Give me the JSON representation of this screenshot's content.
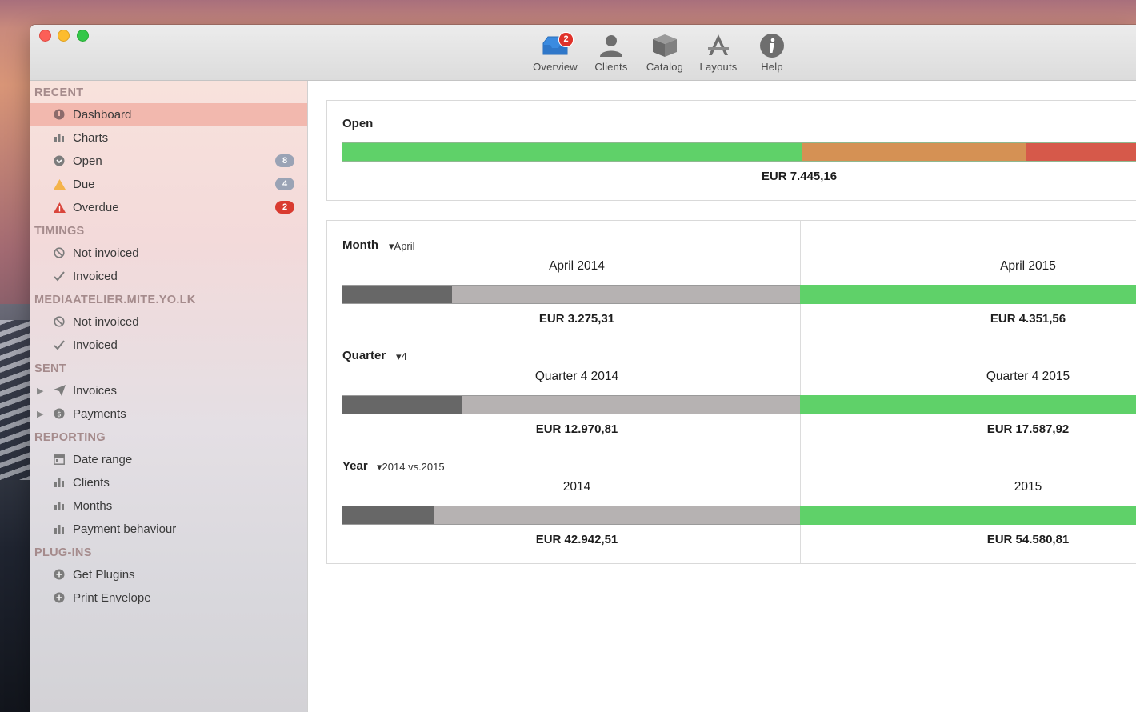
{
  "toolbar": {
    "overview": {
      "label": "Overview",
      "badge": "2"
    },
    "clients": {
      "label": "Clients"
    },
    "catalog": {
      "label": "Catalog"
    },
    "layouts": {
      "label": "Layouts"
    },
    "help": {
      "label": "Help"
    }
  },
  "sidebar": {
    "recent": {
      "header": "RECENT",
      "dashboard": "Dashboard",
      "charts": "Charts",
      "open": "Open",
      "open_badge": "8",
      "due": "Due",
      "due_badge": "4",
      "overdue": "Overdue",
      "overdue_badge": "2"
    },
    "timings": {
      "header": "TIMINGS",
      "not_invoiced": "Not invoiced",
      "invoiced": "Invoiced"
    },
    "account": {
      "header": "MEDIAATELIER.MITE.YO.LK",
      "not_invoiced": "Not invoiced",
      "invoiced": "Invoiced"
    },
    "sent": {
      "header": "SENT",
      "invoices": "Invoices",
      "payments": "Payments"
    },
    "reporting": {
      "header": "REPORTING",
      "date_range": "Date range",
      "clients": "Clients",
      "months": "Months",
      "payment_behaviour": "Payment behaviour"
    },
    "plugins": {
      "header": "PLUG-INS",
      "get_plugins": "Get Plugins",
      "print_envelope": "Print Envelope"
    }
  },
  "open_panel": {
    "title": "Open",
    "total": "EUR 7.445,16",
    "segments": [
      {
        "fraction": 0.565,
        "color": "#5fd169"
      },
      {
        "fraction": 0.275,
        "color": "#d59154"
      },
      {
        "fraction": 0.16,
        "color": "#d6594a"
      }
    ]
  },
  "comparison": {
    "month": {
      "label": "Month",
      "selector": "April",
      "left": {
        "heading": "April 2014",
        "amount": "EUR 3.275,31",
        "dark_fraction": 0.24
      },
      "right": {
        "heading": "April 2015",
        "amount": "EUR 4.351,56"
      }
    },
    "quarter": {
      "label": "Quarter",
      "selector": "4",
      "left": {
        "heading": "Quarter 4 2014",
        "amount": "EUR 12.970,81",
        "dark_fraction": 0.26
      },
      "right": {
        "heading": "Quarter 4 2015",
        "amount": "EUR 17.587,92"
      }
    },
    "year": {
      "label": "Year",
      "selector": "2014 vs.2015",
      "left": {
        "heading": "2014",
        "amount": "EUR 42.942,51",
        "dark_fraction": 0.2
      },
      "right": {
        "heading": "2015",
        "amount": "EUR 54.580,81"
      }
    }
  },
  "colors": {
    "green": "#5fd169",
    "dark_grey": "#676767",
    "light_grey": "#b6b2b2",
    "accent_selected": "#f2b8ae"
  }
}
